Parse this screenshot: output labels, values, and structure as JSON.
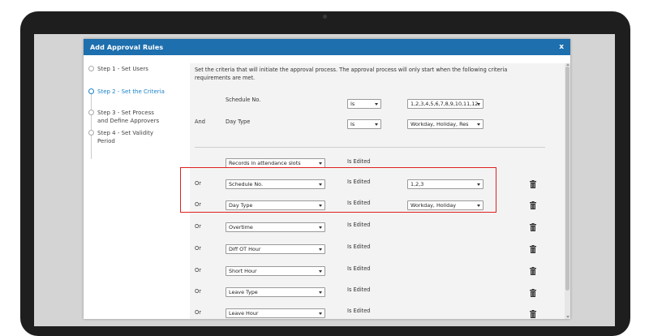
{
  "dialog": {
    "title": "Add Approval Rules",
    "close": "x"
  },
  "steps": [
    {
      "label": "Step 1 - Set Users",
      "active": false
    },
    {
      "label": "Step 2 - Set the Criteria",
      "active": true
    },
    {
      "label": "Step 3 - Set Process and Define Approvers",
      "active": false
    },
    {
      "label": "Step 4 - Set Validity Period",
      "active": false
    }
  ],
  "intro": "Set the criteria that will initiate the approval process. The approval process will only start when the following criteria requirements are met.",
  "criteria": [
    {
      "connector": "",
      "field": "Schedule No.",
      "operator": "Is",
      "value": "1,2,3,4,5,6,7,8,9,10,11,12,"
    },
    {
      "connector": "And",
      "field": "Day Type",
      "operator": "Is",
      "value": "Workday, Holiday, Res"
    }
  ],
  "edit_rows": [
    {
      "connector": "",
      "field": "Records in attendance slots",
      "status": "Is Edited",
      "value": "",
      "deletable": false
    },
    {
      "connector": "Or",
      "field": "Schedule No.",
      "status": "Is Edited",
      "value": "1,2,3",
      "deletable": true
    },
    {
      "connector": "Or",
      "field": "Day Type",
      "status": "Is Edited",
      "value": "Workday, Holiday",
      "deletable": true
    },
    {
      "connector": "Or",
      "field": "Overtime",
      "status": "Is Edited",
      "value": "",
      "deletable": true
    },
    {
      "connector": "Or",
      "field": "Diff OT Hour",
      "status": "Is Edited",
      "value": "",
      "deletable": true
    },
    {
      "connector": "Or",
      "field": "Short Hour",
      "status": "Is Edited",
      "value": "",
      "deletable": true
    },
    {
      "connector": "Or",
      "field": "Leave Type",
      "status": "Is Edited",
      "value": "",
      "deletable": true
    },
    {
      "connector": "Or",
      "field": "Leave Hour",
      "status": "Is Edited",
      "value": "",
      "deletable": true
    }
  ],
  "icons": {
    "trash": "trash-icon",
    "dropdown": "chevron-down-icon",
    "step": "radio-circle-icon"
  },
  "colors": {
    "header": "#1d6fae",
    "active_step": "#1a82c8",
    "highlight": "#e02020"
  }
}
